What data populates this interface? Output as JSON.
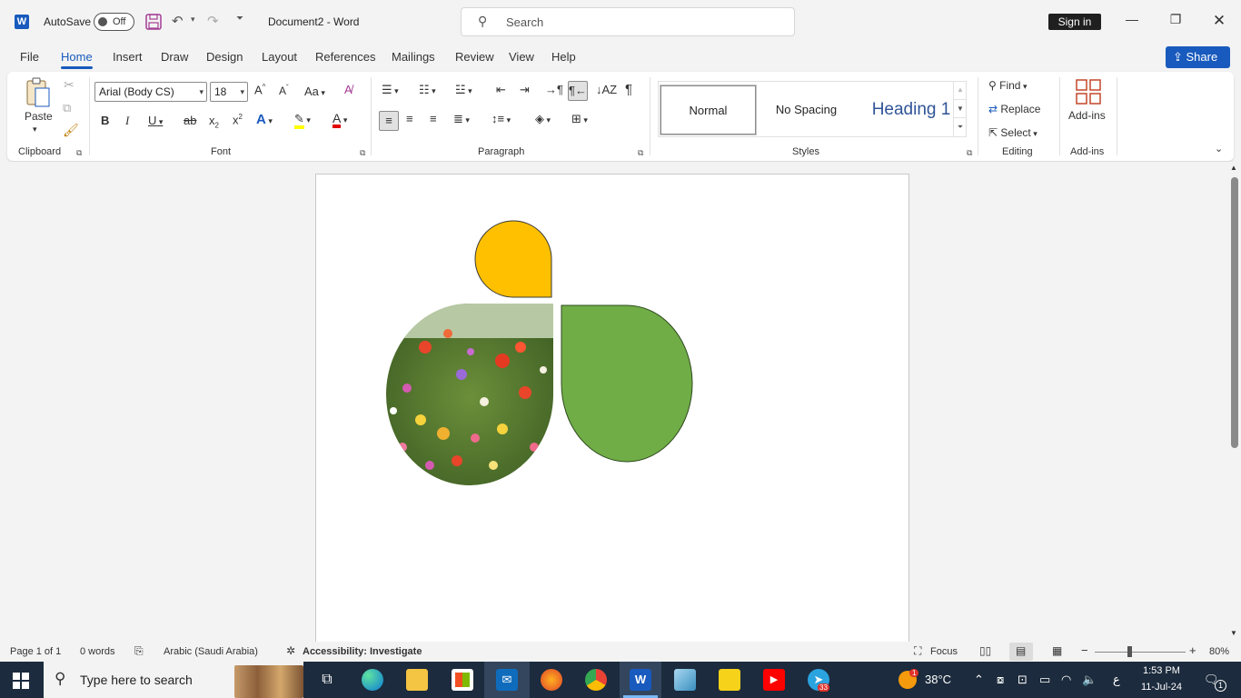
{
  "titlebar": {
    "autosave_label": "AutoSave",
    "autosave_state": "Off",
    "doc_title": "Document2 - Word",
    "search_placeholder": "Search",
    "signin_label": "Sign in"
  },
  "tabs": [
    "File",
    "Home",
    "Insert",
    "Draw",
    "Design",
    "Layout",
    "References",
    "Mailings",
    "Review",
    "View",
    "Help"
  ],
  "share_label": "Share",
  "ribbon": {
    "clipboard": {
      "paste_label": "Paste",
      "group_label": "Clipboard"
    },
    "font": {
      "font_name": "Arial (Body CS)",
      "font_size": "18",
      "group_label": "Font",
      "change_case": "Aa"
    },
    "paragraph": {
      "group_label": "Paragraph"
    },
    "styles": {
      "items": [
        "Normal",
        "No Spacing",
        "Heading 1"
      ],
      "group_label": "Styles"
    },
    "editing": {
      "find": "Find",
      "replace": "Replace",
      "select": "Select",
      "group_label": "Editing"
    },
    "addins": {
      "button_label": "Add-ins",
      "group_label": "Add-ins"
    }
  },
  "statusbar": {
    "page": "Page 1 of 1",
    "words": "0 words",
    "language": "Arabic (Saudi Arabia)",
    "accessibility": "Accessibility: Investigate",
    "focus": "Focus",
    "zoom": "80%"
  },
  "taskbar": {
    "search_placeholder": "Type here to search",
    "temperature": "38°C",
    "weather_badge": "1",
    "telegram_badge": "33",
    "time": "1:53 PM",
    "date": "11-Jul-24",
    "notif_count": "1",
    "input_lang": "ع"
  },
  "colors": {
    "accent": "#185abd",
    "shape_yellow": "#ffc000",
    "shape_green": "#70ad47"
  }
}
